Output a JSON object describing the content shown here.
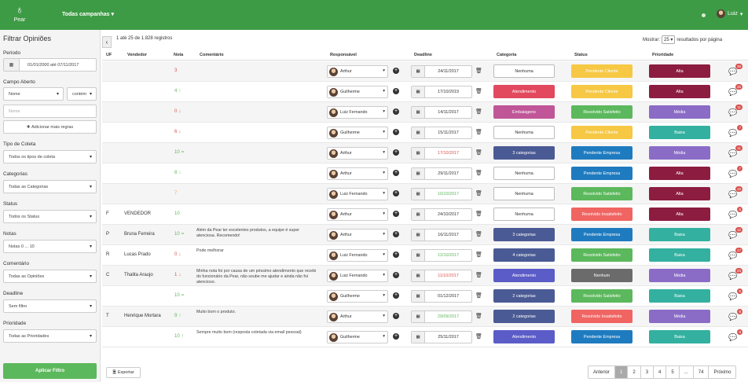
{
  "topbar": {
    "logo_text": "Pear",
    "campaigns": "Todas campanhas",
    "user": "Luiz"
  },
  "sidebar": {
    "title": "Filtrar Opiniões",
    "periodo_label": "Periodo",
    "periodo_value": "01/01/2000 até 07/11/2017",
    "campo_label": "Campo Aberto",
    "campo_field": "Nome",
    "campo_op": "contém",
    "campo_placeholder": "Nome",
    "add_rule": "Adicionar mais regras",
    "tipo_label": "Tipo de Coleta",
    "tipo_value": "Todos os tipos de coleta",
    "categorias_label": "Categorias",
    "categorias_value": "Todas as Categorias",
    "status_label": "Status",
    "status_value": "Todos os Status",
    "notas_label": "Notas",
    "notas_value": "Notas 0 ... 10",
    "comentario_label": "Comentário",
    "comentario_value": "Todas as Opiniões",
    "deadline_label": "Deadline",
    "deadline_value": "Sem filtro",
    "prioridade_label": "Prioridade",
    "prioridade_value": "Todas as Prioridades",
    "apply": "Aplicar Filtro"
  },
  "main": {
    "records": "1 até 25 de 1.828 registros",
    "show_label": "Mostrar:",
    "show_value": "25",
    "show_suffix": "resultados por página",
    "headers": {
      "uf": "UF",
      "vendedor": "Vendedor",
      "nota": "Nota",
      "comentario": "Comentário",
      "responsavel": "Responsável",
      "deadline": "Deadline",
      "categoria": "Categoria",
      "status": "Status",
      "prioridade": "Prioridade"
    },
    "export": "Exportar",
    "pager": [
      "Anterior",
      "1",
      "2",
      "3",
      "4",
      "5",
      "...",
      "74",
      "Próximo"
    ]
  },
  "colors": {
    "green": "#3d9b45",
    "red": "#e2495f",
    "pink": "#c05598",
    "navy": "#4a5a94",
    "blue": "#5b5cc7",
    "yellow": "#f6c844",
    "dblue": "#1f7bbf",
    "okgreen": "#5cb85c",
    "coral": "#f06462",
    "grey": "#6b6b6b",
    "wine": "#8c1d40",
    "purple": "#8a6cc7",
    "teal": "#33b0a0"
  },
  "rows": [
    {
      "uf": "",
      "vendedor": "",
      "nota": "3",
      "nota_color": "#d9534f",
      "arrow": "",
      "comentario": "",
      "resp": "Arthur",
      "deadline": "24/11/2017",
      "deadline_color": "#333",
      "cat": "Nenhuma",
      "cat_color": "white",
      "status": "Pendente Cliente",
      "status_color": "#f6c844",
      "pri": "Alta",
      "pri_color": "#8c1d40",
      "badge": "39"
    },
    {
      "uf": "",
      "vendedor": "",
      "nota": "4",
      "nota_color": "#5cb85c",
      "arrow": "↑",
      "comentario": "",
      "resp": "Guilherme",
      "deadline": "17/10/2019",
      "deadline_color": "#333",
      "cat": "Atendimento",
      "cat_color": "#e2495f",
      "status": "Pendente Cliente",
      "status_color": "#f6c844",
      "pri": "Alta",
      "pri_color": "#8c1d40",
      "badge": "26"
    },
    {
      "uf": "",
      "vendedor": "",
      "nota": "0",
      "nota_color": "#d9534f",
      "arrow": "↓",
      "comentario": "",
      "resp": "Luiz Fernando",
      "deadline": "14/11/2017",
      "deadline_color": "#333",
      "cat": "Embalagens",
      "cat_color": "#c05598",
      "status": "Resolvido Satisfeito",
      "status_color": "#5cb85c",
      "pri": "Média",
      "pri_color": "#8a6cc7",
      "badge": "11"
    },
    {
      "uf": "",
      "vendedor": "",
      "nota": "6",
      "nota_color": "#d9534f",
      "arrow": "↓",
      "comentario": "",
      "resp": "Guilherme",
      "deadline": "15/11/2017",
      "deadline_color": "#333",
      "cat": "Nenhuma",
      "cat_color": "white",
      "status": "Pendente Cliente",
      "status_color": "#f6c844",
      "pri": "Baixa",
      "pri_color": "#33b0a0",
      "badge": "7"
    },
    {
      "uf": "",
      "vendedor": "",
      "nota": "10",
      "nota_color": "#5cb85c",
      "arrow": "=",
      "comentario": "",
      "resp": "Arthur",
      "deadline": "17/10/2017",
      "deadline_color": "#d9534f",
      "cat": "3 categorias",
      "cat_color": "#4a5a94",
      "status": "Pendente Empresa",
      "status_color": "#1f7bbf",
      "pri": "Média",
      "pri_color": "#8a6cc7",
      "badge": "11"
    },
    {
      "uf": "",
      "vendedor": "",
      "nota": "8",
      "nota_color": "#5cb85c",
      "arrow": "↓",
      "comentario": "",
      "resp": "Arthur",
      "deadline": "29/11/2017",
      "deadline_color": "#333",
      "cat": "Nenhuma",
      "cat_color": "white",
      "status": "Pendente Empresa",
      "status_color": "#1f7bbf",
      "pri": "Alta",
      "pri_color": "#8c1d40",
      "badge": "7"
    },
    {
      "uf": "",
      "vendedor": "",
      "nota": "7",
      "nota_color": "#f0ad4e",
      "arrow": "",
      "comentario": "",
      "resp": "Luiz Fernando",
      "deadline": "10/10/2017",
      "deadline_color": "#5cb85c",
      "cat": "Nenhuma",
      "cat_color": "white",
      "status": "Resolvido Satisfeito",
      "status_color": "#5cb85c",
      "pri": "Alta",
      "pri_color": "#8c1d40",
      "badge": "10"
    },
    {
      "uf": "F",
      "vendedor": "VENDEDOR",
      "nota": "10",
      "nota_color": "#5cb85c",
      "arrow": "",
      "comentario": "",
      "resp": "Arthur",
      "deadline": "24/10/2017",
      "deadline_color": "#333",
      "cat": "Nenhuma",
      "cat_color": "white",
      "status": "Resolvido Insatisfeito",
      "status_color": "#f06462",
      "pri": "Alta",
      "pri_color": "#8c1d40",
      "badge": "6"
    },
    {
      "uf": "P",
      "vendedor": "Bruna Ferreira",
      "nota": "10",
      "nota_color": "#5cb85c",
      "arrow": "=",
      "comentario": "Além da Pear ter excelentes produtos, a equipe é super atenciosa. Recomendo!",
      "resp": "Arthur",
      "deadline": "16/11/2017",
      "deadline_color": "#333",
      "cat": "3 categorias",
      "cat_color": "#4a5a94",
      "status": "Pendente Empresa",
      "status_color": "#1f7bbf",
      "pri": "Baixa",
      "pri_color": "#33b0a0",
      "badge": "12"
    },
    {
      "uf": "R",
      "vendedor": "Lucas Prado",
      "nota": "0",
      "nota_color": "#d9534f",
      "arrow": "↓",
      "comentario": "Pode melhorar",
      "resp": "Luiz Fernando",
      "deadline": "12/10/2017",
      "deadline_color": "#5cb85c",
      "cat": "4 categorias",
      "cat_color": "#4a5a94",
      "status": "Resolvido Satisfeito",
      "status_color": "#5cb85c",
      "pri": "Baixa",
      "pri_color": "#33b0a0",
      "badge": "17"
    },
    {
      "uf": "C",
      "vendedor": "Thalita Araujo",
      "nota": "1",
      "nota_color": "#d9534f",
      "arrow": "↓",
      "comentario": "Minha nota foi por causa de um péssimo atendimento que recebi do funcionário da Pear, não soube me ajudar e ainda não foi atencioso.",
      "resp": "Luiz Fernando",
      "deadline": "11/10/2017",
      "deadline_color": "#d9534f",
      "cat": "Atendimento",
      "cat_color": "#5b5cc7",
      "status": "Nenhum",
      "status_color": "#6b6b6b",
      "pri": "Média",
      "pri_color": "#8a6cc7",
      "badge": "23"
    },
    {
      "uf": "",
      "vendedor": "",
      "nota": "10",
      "nota_color": "#5cb85c",
      "arrow": "=",
      "comentario": "",
      "resp": "Guilherme",
      "deadline": "01/12/2017",
      "deadline_color": "#333",
      "cat": "2 categorias",
      "cat_color": "#4a5a94",
      "status": "Resolvido Satisfeito",
      "status_color": "#5cb85c",
      "pri": "Baixa",
      "pri_color": "#33b0a0",
      "badge": "5"
    },
    {
      "uf": "T",
      "vendedor": "Henrique Mortara",
      "nota": "9",
      "nota_color": "#5cb85c",
      "arrow": "↑",
      "comentario": "Muito bom o produto.",
      "resp": "Arthur",
      "deadline": "29/09/2017",
      "deadline_color": "#5cb85c",
      "cat": "2 categorias",
      "cat_color": "#4a5a94",
      "status": "Resolvido Insatisfeito",
      "status_color": "#f06462",
      "pri": "Média",
      "pri_color": "#8a6cc7",
      "badge": "8"
    },
    {
      "uf": "",
      "vendedor": "",
      "nota": "10",
      "nota_color": "#5cb85c",
      "arrow": "↑",
      "comentario": "Sempre muito bom (resposta coletada via email pessoal)",
      "resp": "Guilherme",
      "deadline": "25/11/2017",
      "deadline_color": "#333",
      "cat": "Atendimento",
      "cat_color": "#5b5cc7",
      "status": "Pendente Empresa",
      "status_color": "#1f7bbf",
      "pri": "Baixa",
      "pri_color": "#33b0a0",
      "badge": "8"
    }
  ]
}
